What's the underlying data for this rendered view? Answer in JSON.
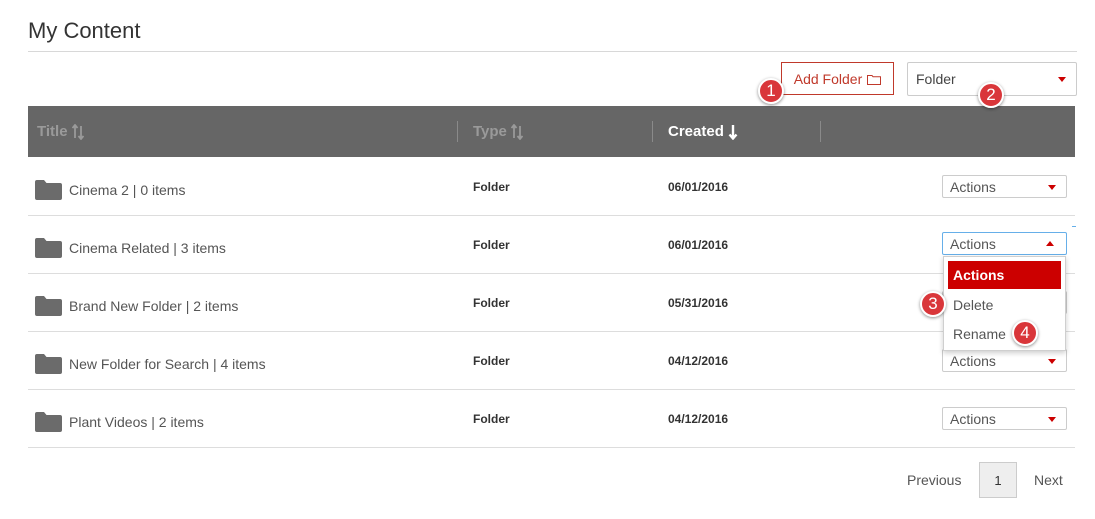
{
  "page": {
    "title": "My Content"
  },
  "toolbar": {
    "add_folder_label": "Add Folder",
    "filter_value": "Folder"
  },
  "table": {
    "columns": [
      {
        "label": "Title",
        "sorted": false
      },
      {
        "label": "Type",
        "sorted": false
      },
      {
        "label": "Created",
        "sorted": true
      }
    ],
    "rows": [
      {
        "title": "Cinema 2 | 0 items",
        "type": "Folder",
        "created": "06/01/2016",
        "actions": "Actions"
      },
      {
        "title": "Cinema Related | 3 items",
        "type": "Folder",
        "created": "06/01/2016",
        "actions": "Actions"
      },
      {
        "title": "Brand New Folder | 2 items",
        "type": "Folder",
        "created": "05/31/2016",
        "actions": "Actions"
      },
      {
        "title": "New Folder for Search | 4 items",
        "type": "Folder",
        "created": "04/12/2016",
        "actions": "Actions"
      },
      {
        "title": "Plant Videos | 2 items",
        "type": "Folder",
        "created": "04/12/2016",
        "actions": "Actions"
      }
    ]
  },
  "actions_menu": {
    "options": [
      "Actions",
      "Delete",
      "Rename"
    ],
    "selected": "Actions"
  },
  "pagination": {
    "previous_label": "Previous",
    "current_page": "1",
    "next_label": "Next"
  },
  "badges": [
    "1",
    "2",
    "3",
    "4"
  ],
  "colors": {
    "accent": "#cc0000",
    "badge": "#d9363a",
    "header_bg": "#666666"
  }
}
